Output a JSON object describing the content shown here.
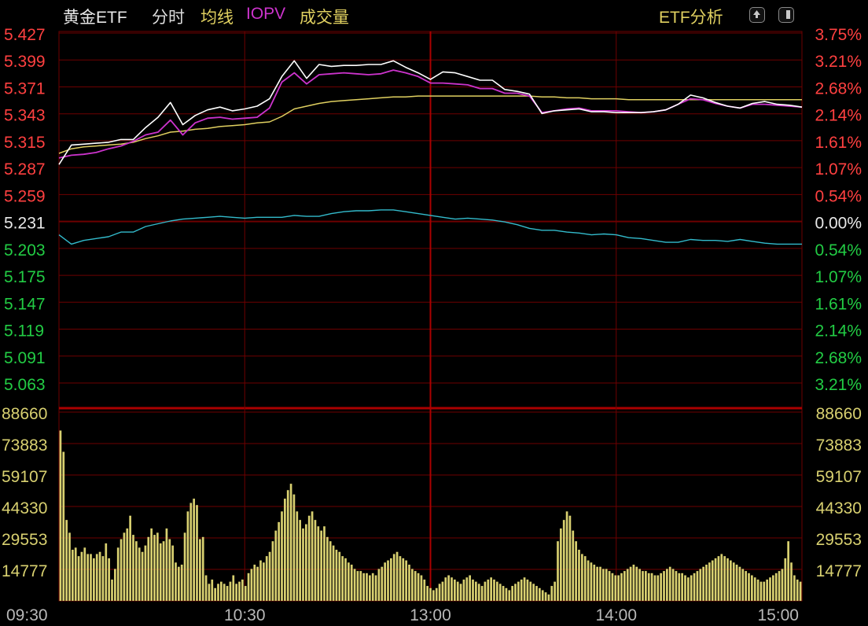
{
  "header": {
    "title": "黄金ETF",
    "tabs": [
      {
        "label": "分时",
        "color": "#dcdcdc"
      },
      {
        "label": "均线",
        "color": "#e0d060"
      },
      {
        "label": "IOPV",
        "color": "#cc33cc"
      },
      {
        "label": "成交量",
        "color": "#e0d060"
      }
    ],
    "analysis_label": "ETF分析",
    "icons": [
      "upload-icon",
      "panel-icon"
    ]
  },
  "colors": {
    "up": "#ff4040",
    "down": "#22cc44",
    "neutral": "#e8e8e8",
    "grid": "#6e0000",
    "price": "#ffffff",
    "iopv": "#cc33cc",
    "avg": "#e0d060",
    "premium": "#33bbcc",
    "volume": "#d8d070"
  },
  "chart_data": {
    "type": "line",
    "price_ticks": [
      "5.427",
      "5.399",
      "5.371",
      "5.343",
      "5.315",
      "5.287",
      "5.259",
      "5.231",
      "5.203",
      "5.175",
      "5.147",
      "5.119",
      "5.091",
      "5.063"
    ],
    "pct_ticks": [
      "3.75%",
      "3.21%",
      "2.68%",
      "2.14%",
      "1.61%",
      "1.07%",
      "0.54%",
      "0.00%",
      "0.54%",
      "1.07%",
      "1.61%",
      "2.14%",
      "2.68%",
      "3.21%"
    ],
    "base_price": 5.231,
    "price_range": [
      5.049,
      5.427
    ],
    "volume_ticks": [
      "88660",
      "73883",
      "59107",
      "44330",
      "29553",
      "14777"
    ],
    "volume_range": [
      0,
      88660
    ],
    "time_ticks": [
      "09:30",
      "10:30",
      "13:00",
      "14:00",
      "15:00"
    ],
    "x_range": [
      0,
      240
    ],
    "series": [
      {
        "key": "price",
        "x": [
          0,
          4,
          8,
          12,
          16,
          20,
          24,
          28,
          32,
          36,
          40,
          44,
          48,
          52,
          56,
          60,
          64,
          68,
          72,
          76,
          80,
          84,
          88,
          92,
          96,
          100,
          104,
          108,
          112,
          116,
          120,
          124,
          128,
          132,
          136,
          140,
          144,
          148,
          152,
          156,
          160,
          164,
          168,
          172,
          176,
          180,
          184,
          188,
          192,
          196,
          200,
          204,
          208,
          212,
          216,
          220,
          224,
          228,
          232,
          236,
          240
        ],
        "y": [
          5.285,
          5.306,
          5.307,
          5.308,
          5.309,
          5.312,
          5.312,
          5.325,
          5.336,
          5.352,
          5.328,
          5.338,
          5.344,
          5.347,
          5.343,
          5.345,
          5.348,
          5.356,
          5.38,
          5.397,
          5.378,
          5.393,
          5.391,
          5.392,
          5.392,
          5.393,
          5.393,
          5.397,
          5.39,
          5.384,
          5.377,
          5.385,
          5.384,
          5.38,
          5.376,
          5.376,
          5.366,
          5.364,
          5.361,
          5.34,
          5.343,
          5.344,
          5.345,
          5.342,
          5.342,
          5.341,
          5.341,
          5.341,
          5.342,
          5.344,
          5.35,
          5.36,
          5.357,
          5.352,
          5.348,
          5.346,
          5.351,
          5.353,
          5.35,
          5.349,
          5.347
        ]
      },
      {
        "key": "iopv",
        "x": [
          0,
          4,
          8,
          12,
          16,
          20,
          24,
          28,
          32,
          36,
          40,
          44,
          48,
          52,
          56,
          60,
          64,
          68,
          72,
          76,
          80,
          84,
          88,
          92,
          96,
          100,
          104,
          108,
          112,
          116,
          120,
          124,
          128,
          132,
          136,
          140,
          144,
          148,
          152,
          156,
          160,
          164,
          168,
          172,
          176,
          180,
          184,
          188,
          192,
          196,
          200,
          204,
          208,
          212,
          216,
          220,
          224,
          228,
          232,
          236,
          240
        ],
        "y": [
          5.292,
          5.295,
          5.296,
          5.298,
          5.302,
          5.305,
          5.31,
          5.317,
          5.32,
          5.333,
          5.317,
          5.33,
          5.335,
          5.336,
          5.334,
          5.335,
          5.336,
          5.346,
          5.374,
          5.384,
          5.372,
          5.382,
          5.383,
          5.384,
          5.383,
          5.382,
          5.383,
          5.387,
          5.384,
          5.38,
          5.373,
          5.373,
          5.372,
          5.371,
          5.367,
          5.367,
          5.362,
          5.362,
          5.359,
          5.341,
          5.343,
          5.345,
          5.346,
          5.343,
          5.343,
          5.343,
          5.342,
          5.341,
          5.342,
          5.344,
          5.35,
          5.356,
          5.355,
          5.351,
          5.348,
          5.346,
          5.35,
          5.35,
          5.349,
          5.348,
          5.347
        ]
      },
      {
        "key": "avg",
        "x": [
          0,
          4,
          8,
          12,
          16,
          20,
          24,
          28,
          32,
          36,
          40,
          44,
          48,
          52,
          56,
          60,
          64,
          68,
          72,
          76,
          80,
          84,
          88,
          92,
          96,
          100,
          104,
          108,
          112,
          116,
          120,
          124,
          128,
          132,
          136,
          140,
          144,
          148,
          152,
          156,
          160,
          164,
          168,
          172,
          176,
          180,
          184,
          188,
          192,
          196,
          200,
          204,
          208,
          212,
          216,
          220,
          224,
          228,
          232,
          236,
          240
        ],
        "y": [
          5.297,
          5.302,
          5.304,
          5.305,
          5.306,
          5.307,
          5.309,
          5.313,
          5.316,
          5.32,
          5.321,
          5.323,
          5.324,
          5.326,
          5.327,
          5.328,
          5.33,
          5.331,
          5.337,
          5.345,
          5.348,
          5.351,
          5.353,
          5.354,
          5.355,
          5.356,
          5.357,
          5.358,
          5.358,
          5.359,
          5.359,
          5.359,
          5.359,
          5.359,
          5.359,
          5.359,
          5.359,
          5.359,
          5.359,
          5.358,
          5.358,
          5.357,
          5.357,
          5.356,
          5.356,
          5.356,
          5.355,
          5.355,
          5.355,
          5.355,
          5.355,
          5.355,
          5.355,
          5.355,
          5.355,
          5.355,
          5.355,
          5.355,
          5.355,
          5.355,
          5.355
        ]
      },
      {
        "key": "premium",
        "x": [
          0,
          4,
          8,
          12,
          16,
          20,
          24,
          28,
          32,
          36,
          40,
          44,
          48,
          52,
          56,
          60,
          64,
          68,
          72,
          76,
          80,
          84,
          88,
          92,
          96,
          100,
          104,
          108,
          112,
          116,
          120,
          124,
          128,
          132,
          136,
          140,
          144,
          148,
          152,
          156,
          160,
          164,
          168,
          172,
          176,
          180,
          184,
          188,
          192,
          196,
          200,
          204,
          208,
          212,
          216,
          220,
          224,
          228,
          232,
          236,
          240
        ],
        "y": [
          5.209,
          5.199,
          5.203,
          5.205,
          5.207,
          5.212,
          5.212,
          5.218,
          5.221,
          5.224,
          5.226,
          5.227,
          5.228,
          5.229,
          5.228,
          5.227,
          5.228,
          5.228,
          5.228,
          5.23,
          5.229,
          5.229,
          5.232,
          5.234,
          5.235,
          5.235,
          5.236,
          5.236,
          5.234,
          5.232,
          5.23,
          5.228,
          5.226,
          5.227,
          5.226,
          5.225,
          5.223,
          5.22,
          5.216,
          5.214,
          5.214,
          5.212,
          5.211,
          5.209,
          5.21,
          5.209,
          5.206,
          5.205,
          5.203,
          5.201,
          5.201,
          5.204,
          5.203,
          5.203,
          5.202,
          5.204,
          5.202,
          5.2,
          5.199,
          5.199,
          5.199
        ]
      }
    ],
    "volume": [
      80000,
      70000,
      38000,
      32000,
      24000,
      25000,
      21000,
      23000,
      25000,
      22000,
      22000,
      20000,
      22000,
      23000,
      21000,
      27000,
      20000,
      10000,
      15000,
      25000,
      29000,
      32000,
      34000,
      40000,
      31000,
      28000,
      25000,
      23000,
      26000,
      30000,
      34000,
      31000,
      32000,
      27000,
      28000,
      34000,
      29000,
      26000,
      18000,
      16000,
      17000,
      32000,
      42000,
      46000,
      48000,
      45000,
      29000,
      30000,
      12000,
      8000,
      10000,
      6000,
      8000,
      9000,
      8000,
      7000,
      9000,
      12000,
      8000,
      9000,
      10000,
      7000,
      13000,
      15000,
      17000,
      16000,
      19000,
      18000,
      21000,
      23000,
      28000,
      33000,
      37000,
      42000,
      48000,
      52000,
      55000,
      50000,
      42000,
      38000,
      34000,
      36000,
      40000,
      42000,
      38000,
      35000,
      33000,
      35000,
      30000,
      28000,
      26000,
      24000,
      23000,
      21000,
      20000,
      18000,
      17000,
      15000,
      14000,
      14000,
      13000,
      13000,
      12000,
      13000,
      12000,
      15000,
      16000,
      18000,
      19000,
      20000,
      22000,
      23000,
      21000,
      20000,
      19000,
      17000,
      15000,
      14000,
      13000,
      12000,
      10000,
      7000,
      6000,
      5000,
      6000,
      8000,
      9000,
      11000,
      12000,
      11000,
      10000,
      9000,
      8000,
      10000,
      11000,
      12000,
      10000,
      9000,
      8000,
      7000,
      9000,
      10000,
      11000,
      10000,
      9000,
      8000,
      7000,
      6000,
      5000,
      7000,
      8000,
      9000,
      10000,
      11000,
      10000,
      9000,
      8000,
      7000,
      6000,
      5000,
      4000,
      3000,
      7000,
      9000,
      28000,
      34000,
      38000,
      42000,
      40000,
      33000,
      28000,
      24000,
      22000,
      21000,
      19000,
      18000,
      17000,
      16000,
      16000,
      15000,
      15000,
      14000,
      13000,
      12000,
      12000,
      13000,
      14000,
      15000,
      16000,
      17000,
      16000,
      15000,
      14000,
      14000,
      13000,
      13000,
      12000,
      12000,
      13000,
      14000,
      15000,
      16000,
      15000,
      14000,
      13000,
      13000,
      12000,
      11000,
      12000,
      13000,
      14000,
      15000,
      16000,
      17000,
      18000,
      19000,
      20000,
      21000,
      22000,
      21000,
      20000,
      19000,
      18000,
      17000,
      16000,
      15000,
      14000,
      13000,
      12000,
      11000,
      10000,
      9000,
      9000,
      10000,
      11000,
      12000,
      13000,
      14000,
      15000,
      20000,
      28000,
      18000,
      12000,
      10000,
      9000
    ]
  }
}
